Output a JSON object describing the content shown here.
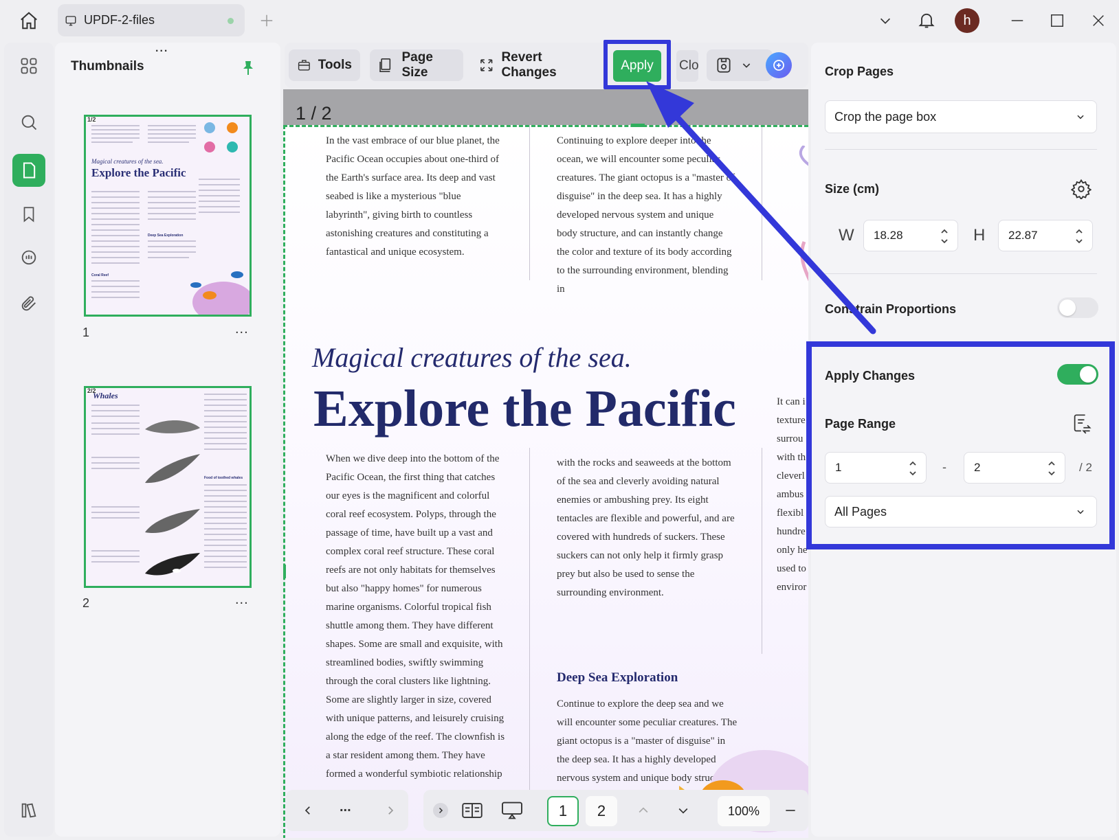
{
  "tab": {
    "title": "UPDF-2-files"
  },
  "user": {
    "initial": "h"
  },
  "thumbnails": {
    "title": "Thumbnails",
    "pages": [
      {
        "label": "1",
        "tag": "1/2",
        "script": "Magical creatures of the sea.",
        "heading": "Explore the Pacific",
        "small_heading": "Deep Sea Exploration",
        "small_heading2": "Coral Reef"
      },
      {
        "label": "2",
        "tag": "2/2",
        "heading": "Whales",
        "small_heading": "Food of toothed whales"
      }
    ],
    "more": "..."
  },
  "toolbar": {
    "tools": "Tools",
    "page_size": "Page Size",
    "revert": "Revert Changes",
    "apply": "Apply",
    "close": "Close"
  },
  "document": {
    "page_indicator": "1 / 2",
    "col1_top": "In the vast embrace of our blue planet, the Pacific Ocean occupies about one-third of the Earth's surface area. Its deep and vast seabed is like a mysterious \"blue labyrinth\", giving birth to countless astonishing creatures and constituting a fantastical and unique ecosystem.",
    "col2_top": "Continuing to explore deeper into the ocean, we will encounter some peculiar creatures. The giant octopus is a \"master of disguise\" in the deep sea. It has a highly developed nervous system and unique body structure, and can instantly change the color and texture of its body according to the surrounding environment, blending in",
    "subtitle": "Magical creatures of the sea.",
    "title": "Explore the Pacific",
    "col1_bottom": "When we dive deep into the bottom of the Pacific Ocean, the first thing that catches our eyes is the magnificent and colorful coral reef ecosystem. Polyps, through the passage of time, have built up a vast and complex coral reef structure. These coral reefs are not only habitats for themselves but also \"happy homes\" for numerous marine organisms. Colorful tropical fish shuttle among them. They have different shapes. Some are small and exquisite, with streamlined bodies, swiftly swimming through the coral clusters like lightning. Some are slightly larger in size, covered with unique patterns, and leisurely cruising along the edge of the reef. The clownfish is a star resident among them. They have formed a wonderful symbiotic relationship",
    "col2_bottom": "with the rocks and seaweeds at the bottom of the sea and cleverly avoiding natural enemies or ambushing prey. Its eight tentacles are flexible and powerful, and are covered with hundreds of suckers. These suckers can not only help it firmly grasp prey but also be used to sense the surrounding environment.",
    "deep_heading": "Deep Sea Exploration",
    "col2_deep": "Continue to explore the deep sea and we will encounter some peculiar creatures. The giant octopus is a \"master of disguise\" in the deep sea. It has a highly developed nervous system and unique body structure.",
    "col3_words": [
      "It can i",
      "texture",
      "surrou",
      "with th",
      "cleverl",
      "ambus",
      "flexibl",
      "hundre",
      "only he",
      "used to",
      "enviror"
    ]
  },
  "bottom_nav": {
    "more": "...",
    "pages": [
      "1",
      "2"
    ],
    "zoom": "100%"
  },
  "crop_panel": {
    "title": "Crop Pages",
    "crop_mode": "Crop the page box",
    "size_label": "Size (cm)",
    "w_label": "W",
    "w_value": "18.28",
    "h_label": "H",
    "h_value": "22.87",
    "constrain_label": "Constrain Proportions",
    "constrain_on": false,
    "apply_changes_label": "Apply Changes",
    "apply_changes_on": true,
    "page_range_label": "Page Range",
    "range_from": "1",
    "range_sep": "-",
    "range_to": "2",
    "range_total": "/ 2",
    "range_mode": "All Pages"
  },
  "colors": {
    "accent": "#2fae5d",
    "highlight": "#3338d9",
    "title": "#242a6e"
  }
}
